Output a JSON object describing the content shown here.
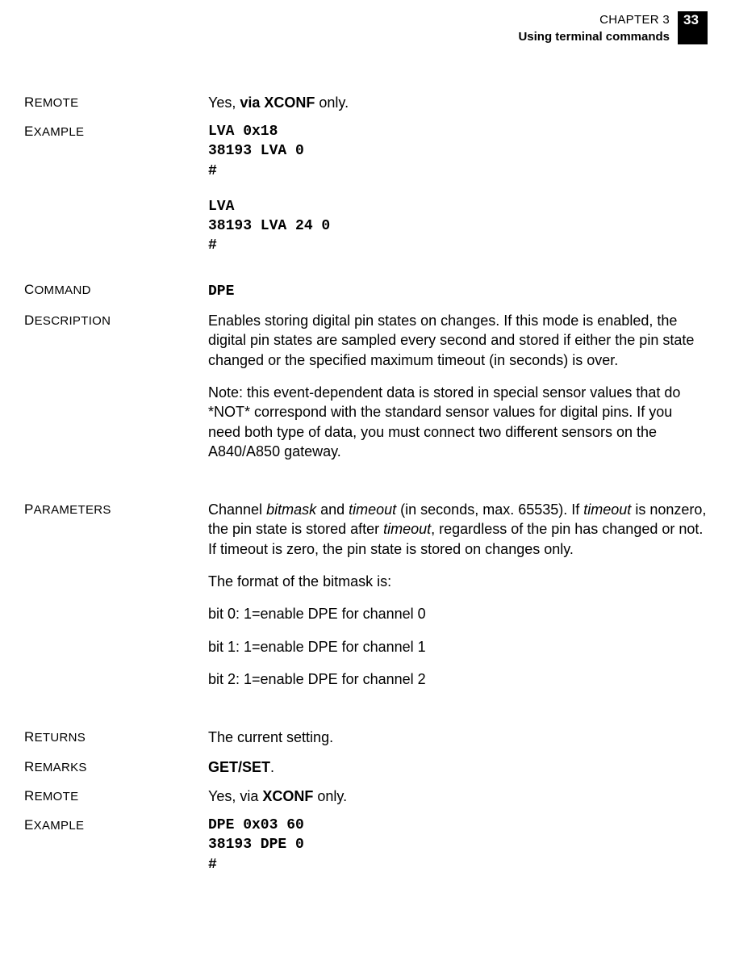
{
  "header": {
    "chapter": "CHAPTER 3",
    "section": "Using terminal commands",
    "page_number": "33"
  },
  "rows": {
    "remote1": {
      "label_first": "R",
      "label_rest": "EMOTE",
      "text_prefix": "Yes, ",
      "text_bold": "via XCONF",
      "text_suffix": " only."
    },
    "example1": {
      "label_first": "E",
      "label_rest": "XAMPLE",
      "block1": "LVA 0x18\n38193 LVA 0\n#",
      "block2": "LVA\n38193 LVA 24 0\n#"
    },
    "command": {
      "label_first": "C",
      "label_rest": "OMMAND",
      "code": "DPE"
    },
    "description": {
      "label_first": "D",
      "label_rest": "ESCRIPTION",
      "p1": "Enables storing digital pin states on changes. If this mode is enabled, the digital pin states are sampled every second and stored if either the pin state changed or the specified maximum timeout (in seconds) is over.",
      "p2": "Note: this event-dependent data is stored in special sensor values that do *NOT* correspond with the standard sensor values for digital pins. If you need both type of data, you must connect two different sensors on the A840/A850 gateway."
    },
    "parameters": {
      "label_first": "P",
      "label_rest": "ARAMETERS",
      "p1_a": "Channel ",
      "p1_b": "bitmask",
      "p1_c": " and ",
      "p1_d": "timeout",
      "p1_e": " (in seconds, max. 65535). If ",
      "p1_f": "timeout",
      "p1_g": " is nonzero, the pin state is stored after ",
      "p1_h": "timeout",
      "p1_i": ", regardless of the pin has changed or not. If timeout is zero, the pin state is stored on changes only.",
      "p2": "The format of the bitmask is:",
      "p3": "bit 0: 1=enable DPE for channel 0",
      "p4": "bit 1: 1=enable DPE for channel 1",
      "p5": "bit 2: 1=enable DPE for channel 2"
    },
    "returns": {
      "label_first": "R",
      "label_rest": "ETURNS",
      "text": "The current setting."
    },
    "remarks": {
      "label_first": "R",
      "label_rest": "EMARKS",
      "bold": "GET/SET",
      "suffix": "."
    },
    "remote2": {
      "label_first": "R",
      "label_rest": "EMOTE",
      "text_prefix": "Yes, via ",
      "text_bold": "XCONF",
      "text_suffix": " only."
    },
    "example2": {
      "label_first": "E",
      "label_rest": "XAMPLE",
      "block": "DPE 0x03 60\n38193 DPE 0\n#"
    }
  }
}
